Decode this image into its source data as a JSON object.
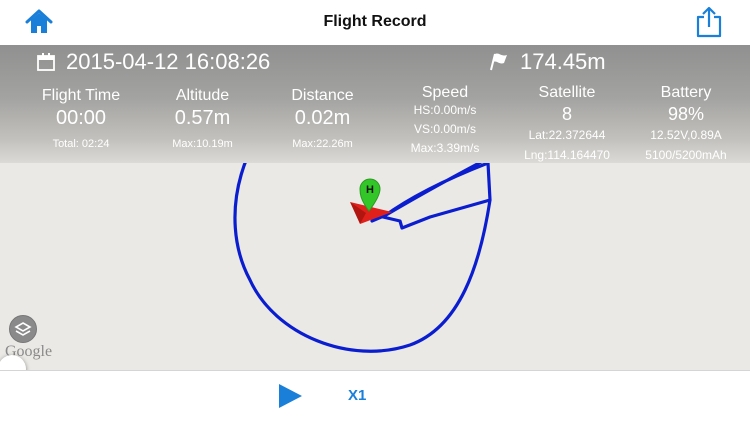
{
  "header": {
    "title": "Flight Record",
    "home_icon": "home-icon",
    "share_icon": "share-icon"
  },
  "summary": {
    "date": "2015-04-12 16:08:26",
    "total_distance": "174.45m",
    "calendar_icon": "calendar-icon",
    "flag_icon": "flag-icon"
  },
  "stats": {
    "flight_time": {
      "label": "Flight Time",
      "value": "00:00",
      "sub": "Total: 02:24"
    },
    "altitude": {
      "label": "Altitude",
      "value": "0.57m",
      "sub": "Max:10.19m"
    },
    "distance": {
      "label": "Distance",
      "value": "0.02m",
      "sub": "Max:22.26m"
    },
    "speed": {
      "label": "Speed",
      "hs": "HS:0.00m/s",
      "vs": "VS:0.00m/s",
      "max": "Max:3.39m/s"
    },
    "satellite": {
      "label": "Satellite",
      "value": "8",
      "lat": "Lat:22.372644",
      "lng": "Lng:114.164470"
    },
    "battery": {
      "label": "Battery",
      "value": "98%",
      "power": "12.52V,0.89A",
      "capacity": "5100/5200mAh"
    }
  },
  "map": {
    "home_marker_label": "H",
    "attribution": "Google",
    "layers_icon": "layers-icon",
    "track_color": "#0a1ecf"
  },
  "playback": {
    "play_icon": "play-icon",
    "speed_label": "X1",
    "progress": 0
  },
  "colors": {
    "accent": "#1a7fd9",
    "track": "#0a1ecf",
    "aircraft": "#e0201a",
    "home_marker": "#33c628"
  }
}
